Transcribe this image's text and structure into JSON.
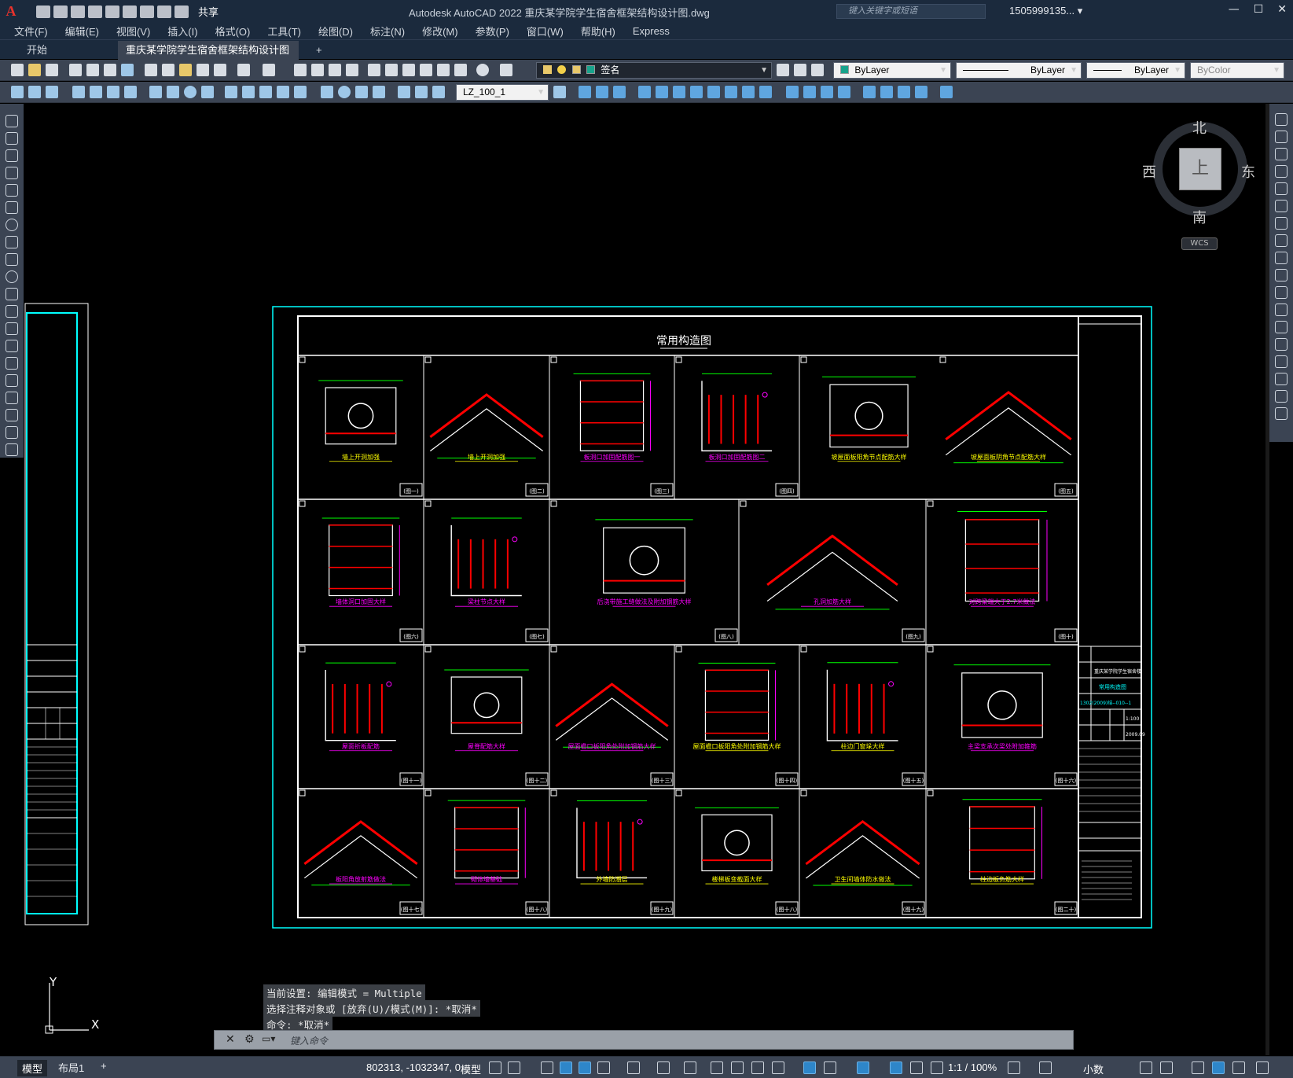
{
  "app": {
    "logo": "A",
    "title": "Autodesk AutoCAD 2022    重庆某学院学生宿舍框架结构设计图.dwg",
    "share_label": "共享",
    "search_placeholder": "键入关键字或短语",
    "user": "1505999135... ▾",
    "window_controls": [
      "—",
      "☐",
      "✕"
    ]
  },
  "menu": [
    "文件(F)",
    "编辑(E)",
    "视图(V)",
    "插入(I)",
    "格式(O)",
    "工具(T)",
    "绘图(D)",
    "标注(N)",
    "修改(M)",
    "参数(P)",
    "窗口(W)",
    "帮助(H)",
    "Express"
  ],
  "tabs": {
    "start": "开始",
    "active": "重庆某学院学生宿舍框架结构设计图*",
    "close": "✕",
    "add": "+"
  },
  "toolbar": {
    "layer": "签名",
    "color": "ByLayer",
    "linetype": "ByLayer",
    "lineweight": "ByLayer",
    "plotstyle": "ByColor",
    "dimstyle": "LZ_100_1"
  },
  "viewcube": {
    "north": "北",
    "south": "南",
    "east": "东",
    "west": "西",
    "face": "上",
    "wcs": "WCS"
  },
  "drawing": {
    "sheet_title": "常用构造图",
    "details": [
      {
        "caption": "墙上开洞加强",
        "tag": "(图一)"
      },
      {
        "caption": "墙上开洞加强",
        "tag": "(图二)"
      },
      {
        "caption": "板洞口加固配筋图一",
        "tag": "(图三)"
      },
      {
        "caption": "板洞口加固配筋图二",
        "tag": "(图四)"
      },
      {
        "caption": "坡屋面板阳角节点配筋大样",
        "tag": ""
      },
      {
        "caption": "坡屋面板阴角节点配筋大样",
        "tag": "(图五)"
      },
      {
        "caption": "墙体洞口加固大样",
        "tag": "(图六)"
      },
      {
        "caption": "梁柱节点大样",
        "tag": "(图七)"
      },
      {
        "caption": "后浇带施工缝做法及附加钢筋大样",
        "tag": "(图八)"
      },
      {
        "caption": "孔洞加筋大样",
        "tag": "(图九)"
      },
      {
        "caption": "对跨梁端大于2.7米做法",
        "tag": "(图十)"
      },
      {
        "caption": "屋面折板配筋",
        "tag": "(图十一)"
      },
      {
        "caption": "屋脊配筋大样",
        "tag": "(图十二)"
      },
      {
        "caption": "屋面檐口板阳角处附加钢筋大样",
        "tag": "(图十三)"
      },
      {
        "caption": "屋面檐口板阳角处附加钢筋大样",
        "tag": "(图十四)"
      },
      {
        "caption": "柱边门窗垛大样",
        "tag": "(图十五)"
      },
      {
        "caption": "主梁支承次梁处附加箍筋",
        "tag": "(图十六)"
      },
      {
        "caption": "板阳角放射筋做法",
        "tag": "(图十七)"
      },
      {
        "caption": "砌体墙基础",
        "tag": "(图十八)"
      },
      {
        "caption": "外墙防潮层",
        "tag": "(图十九)"
      },
      {
        "caption": "楼梯板变截面大样",
        "tag": "(图十八)"
      },
      {
        "caption": "卫生间墙体防水做法",
        "tag": "(图十九)"
      },
      {
        "caption": "柱边板负筋大样",
        "tag": "(图二十)"
      }
    ],
    "title_block": {
      "project": "重庆某学院学生宿舍楼",
      "name": "常用构造图",
      "number": "1302(2009)结--010--1",
      "scale": "1:100",
      "date": "2009.09"
    }
  },
  "command": {
    "history": [
      "当前设置: 编辑模式 = Multiple",
      "选择注释对象或 [放弃(U)/模式(M)]: *取消*",
      "命令: *取消*"
    ],
    "placeholder": "键入命令"
  },
  "ucs": {
    "x": "X",
    "y": "Y"
  },
  "status": {
    "tabs": [
      "模型",
      "布局1",
      "+"
    ],
    "coords": "802313, -1032347, 0",
    "mode": "模型",
    "scale": "1:1 / 100%",
    "units": "小数"
  },
  "colors": {
    "frame": "#00ffff",
    "border": "#ffffff",
    "rebar": "#ff0000",
    "caption": "#ff00ff",
    "caption_alt": "#ffff00",
    "dim": "#00ff00"
  }
}
